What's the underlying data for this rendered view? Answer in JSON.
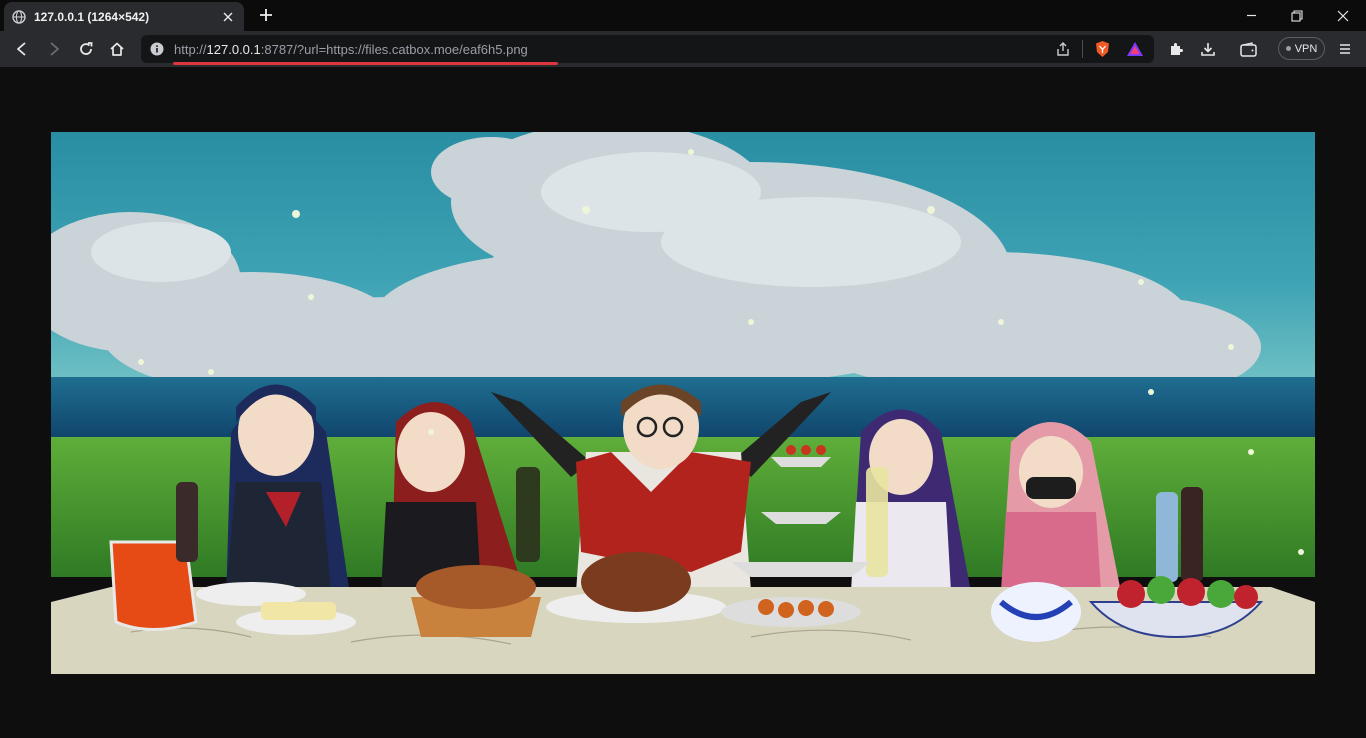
{
  "tab": {
    "title": "127.0.0.1 (1264×542)"
  },
  "address_bar": {
    "url_scheme": "http://",
    "url_host": "127.0.0.1",
    "url_rest": ":8787/?url=https://files.catbox.moe/eaf6h5.png"
  },
  "vpn_label": "VPN",
  "image": {
    "natural_width": 1264,
    "natural_height": 542,
    "description_icon": "anime-feast-picnic-image"
  },
  "colors": {
    "tab_bg": "#2a2b2f",
    "toolbar_bg": "#2a2b2f",
    "page_bg": "#0e0e0f",
    "url_underline": "#e0343f",
    "brave_orange": "#f05a24"
  }
}
